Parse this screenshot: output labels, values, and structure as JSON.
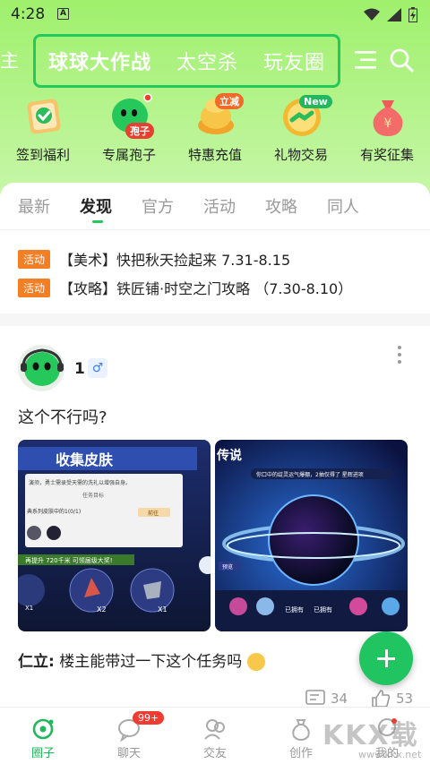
{
  "status_bar": {
    "time": "4:28",
    "notif_icon": "A"
  },
  "header": {
    "partial_tab": "主",
    "tabs": [
      {
        "label": "球球大作战",
        "active": true
      },
      {
        "label": "太空杀",
        "active": false
      },
      {
        "label": "玩友圈",
        "active": false
      }
    ],
    "tab_border_color": "#23c95b"
  },
  "quick_actions": [
    {
      "label": "签到福利",
      "icon": "sign-in-icon"
    },
    {
      "label": "专属孢子",
      "icon": "spore-icon",
      "badge": "孢子"
    },
    {
      "label": "特惠充值",
      "icon": "coin-icon",
      "badge": "立减"
    },
    {
      "label": "礼物交易",
      "icon": "gift-trade-icon",
      "badge": "New"
    },
    {
      "label": "有奖征集",
      "icon": "money-bag-icon"
    }
  ],
  "content_tabs": [
    {
      "label": "最新",
      "active": false
    },
    {
      "label": "发现",
      "active": true
    },
    {
      "label": "官方",
      "active": false
    },
    {
      "label": "活动",
      "active": false
    },
    {
      "label": "攻略",
      "active": false
    },
    {
      "label": "同人",
      "active": false
    }
  ],
  "notices": [
    {
      "tag": "活动",
      "text": "【美术】快把秋天捡起来 7.31-8.15"
    },
    {
      "tag": "活动",
      "text": "【攻略】铁匠铺·时空之门攻略 （7.30-8.10）"
    }
  ],
  "post": {
    "username": "1",
    "gender_symbol": "♂",
    "title": "这个不行吗?",
    "image1": {
      "heading": "收集皮肤",
      "line1": "演须，勇士需录受天需的洗礼以增强自身。",
      "sub": "任务目标",
      "row": "典系列皮肤中的1(0/1)",
      "btn": "前往",
      "bar": "再提升 720千米 可领届级大奖!",
      "x1": "X1",
      "x2": "X2",
      "x3": "X1"
    },
    "image2": {
      "heading": "传说",
      "bar": "你口中的绽灵运气爆棚，2抽仅得了 星辉进项",
      "tag": "预览",
      "s1": "已拥有",
      "s2": "已拥有"
    },
    "comment_user": "仁立:",
    "comment_text": "楼主能带过一下这个任务吗",
    "comments_count": "34",
    "likes_count": "53"
  },
  "bottom_nav": [
    {
      "label": "圈子",
      "icon": "circle-icon",
      "active": true
    },
    {
      "label": "聊天",
      "icon": "chat-icon",
      "badge": "99+"
    },
    {
      "label": "交友",
      "icon": "friends-icon"
    },
    {
      "label": "创作",
      "icon": "create-icon"
    },
    {
      "label": "我的",
      "icon": "profile-icon"
    }
  ],
  "watermark": {
    "main": "KKX载",
    "sub": "www.kkx.net"
  },
  "colors": {
    "accent": "#23c95b",
    "tag": "#f37e24",
    "fab": "#20c460",
    "badge_red": "#ef3b32"
  }
}
